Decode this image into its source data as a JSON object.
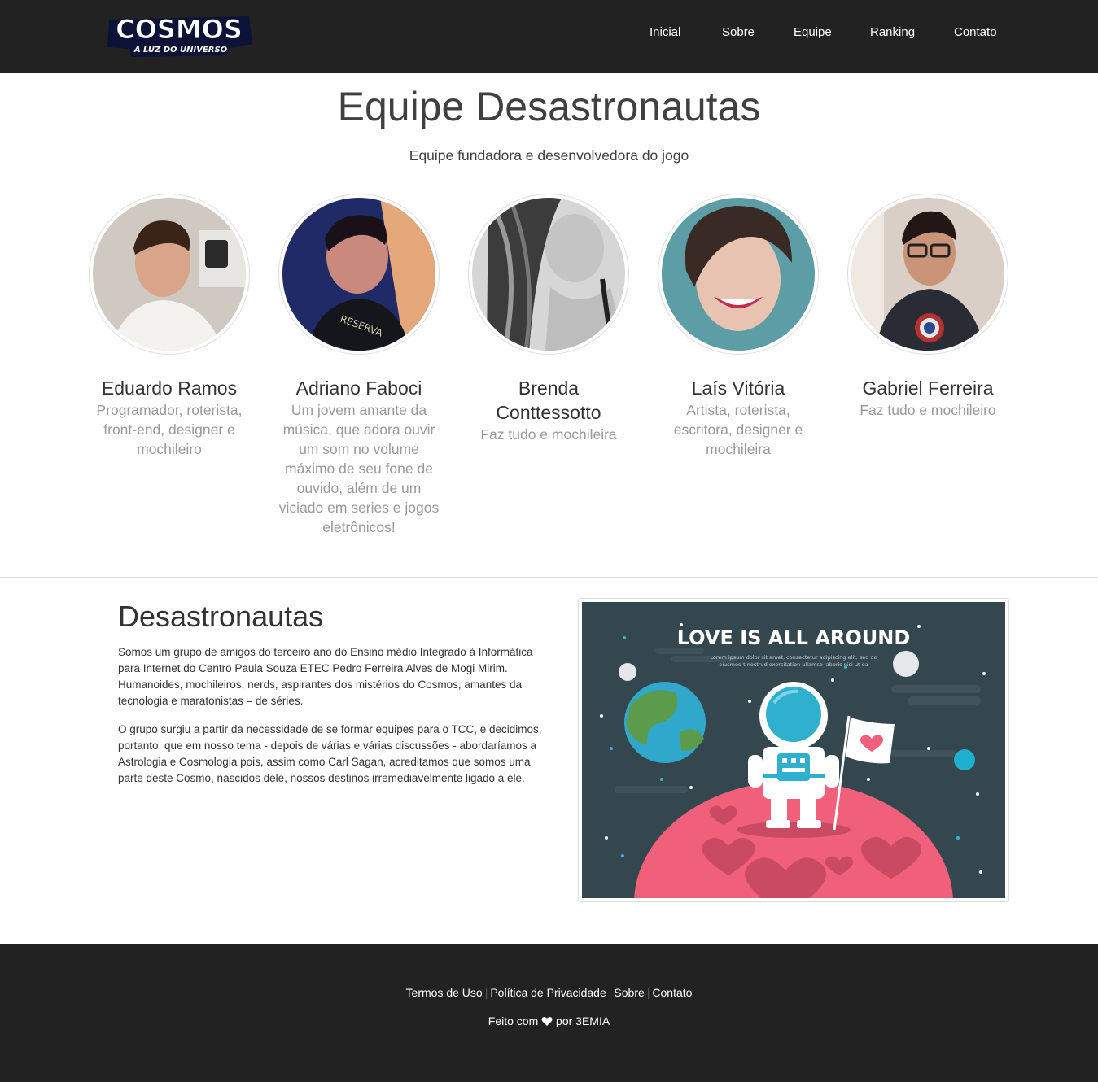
{
  "logo": {
    "title": "COSMOS",
    "tagline": "A LUZ DO UNIVERSO"
  },
  "nav": {
    "items": [
      {
        "label": "Inicial"
      },
      {
        "label": "Sobre"
      },
      {
        "label": "Equipe"
      },
      {
        "label": "Ranking"
      },
      {
        "label": "Contato"
      }
    ]
  },
  "header": {
    "title": "Equipe Desastronautas",
    "subtitle": "Equipe fundadora e desenvolvedora do jogo"
  },
  "team": [
    {
      "name": "Eduardo Ramos",
      "role": "Programador, roterista, front-end, designer e mochileiro"
    },
    {
      "name": "Adriano Faboci",
      "role": "Um jovem amante da música, que adora ouvir um som no volume máximo de seu fone de ouvido, além de um viciado em series e jogos eletrônicos!"
    },
    {
      "name": "Brenda Conttessotto",
      "role": "Faz tudo e mochileira"
    },
    {
      "name": "Laís Vitória",
      "role": "Artista, roterista, escritora, designer e mochileira"
    },
    {
      "name": "Gabriel Ferreira",
      "role": "Faz tudo e mochileiro"
    }
  ],
  "about": {
    "title": "Desastronautas",
    "paragraphs": [
      "Somos um grupo de amigos do terceiro ano do Ensino médio Integrado à Informática para Internet do Centro Paula Souza ETEC Pedro Ferreira Alves de Mogi Mirim. Humanoides, mochileiros, nerds, aspirantes dos mistérios do Cosmos, amantes da tecnologia e maratonistas – de séries.",
      "O grupo surgiu a partir da necessidade de se formar equipes para o TCC, e decidimos, portanto, que em nosso tema - depois de várias e várias discussões - abordaríamos a Astrologia e Cosmologia pois, assim como Carl Sagan, acreditamos que somos uma parte deste Cosmo, nascidos dele, nossos destinos irremediavelmente ligado a ele."
    ],
    "image": {
      "headline": "LOVE IS ALL AROUND",
      "lorem_1": "Lorem ipsum dolor sit amet, consectetur adipiscing elit, sed do",
      "lorem_2": "eiusmod t nostrud exercitation ullamco laboris nisi ut ea"
    }
  },
  "footer": {
    "links": [
      {
        "label": "Termos de Uso"
      },
      {
        "label": "Política de Privacidade"
      },
      {
        "label": "Sobre"
      },
      {
        "label": "Contato"
      }
    ],
    "credit_prefix": "Feito com",
    "credit_suffix": "por 3EMIA",
    "credit_icon": "heart-icon"
  },
  "colors": {
    "navbar_bg": "#222222",
    "footer_bg": "#222222",
    "heading_text": "#404040",
    "muted_text": "#999999",
    "space_bg": "#34474f",
    "planet_pink": "#f0607a"
  }
}
